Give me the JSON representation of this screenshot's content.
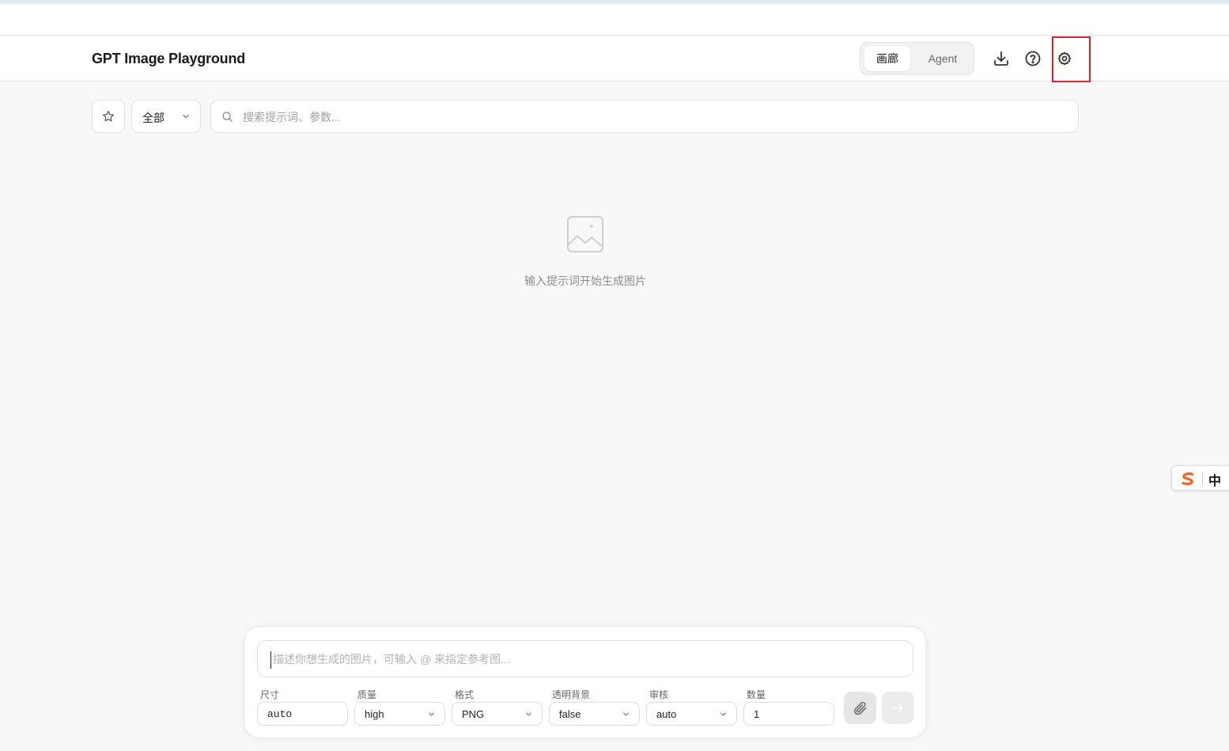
{
  "header": {
    "title": "GPT Image Playground",
    "tabs": [
      {
        "label": "画廊",
        "active": true
      },
      {
        "label": "Agent",
        "active": false
      }
    ],
    "icons": [
      "download-icon",
      "help-icon",
      "settings-icon"
    ]
  },
  "filter": {
    "category_selected": "全部",
    "search_placeholder": "搜索提示词、参数..."
  },
  "empty_state": {
    "message": "输入提示词开始生成图片"
  },
  "ime": {
    "mode": "中"
  },
  "composer": {
    "prompt_placeholder": "描述你想生成的图片，可输入 @ 来指定参考图...",
    "params": [
      {
        "label": "尺寸",
        "value": "auto",
        "type": "input"
      },
      {
        "label": "质量",
        "value": "high",
        "type": "select"
      },
      {
        "label": "格式",
        "value": "PNG",
        "type": "select"
      },
      {
        "label": "透明背景",
        "value": "false",
        "type": "select"
      },
      {
        "label": "审核",
        "value": "auto",
        "type": "select"
      },
      {
        "label": "数量",
        "value": "1",
        "type": "input"
      }
    ]
  },
  "colors": {
    "highlight": "#d9232e",
    "page_bg": "#f8f8f8",
    "header_bg": "#ffffff"
  }
}
